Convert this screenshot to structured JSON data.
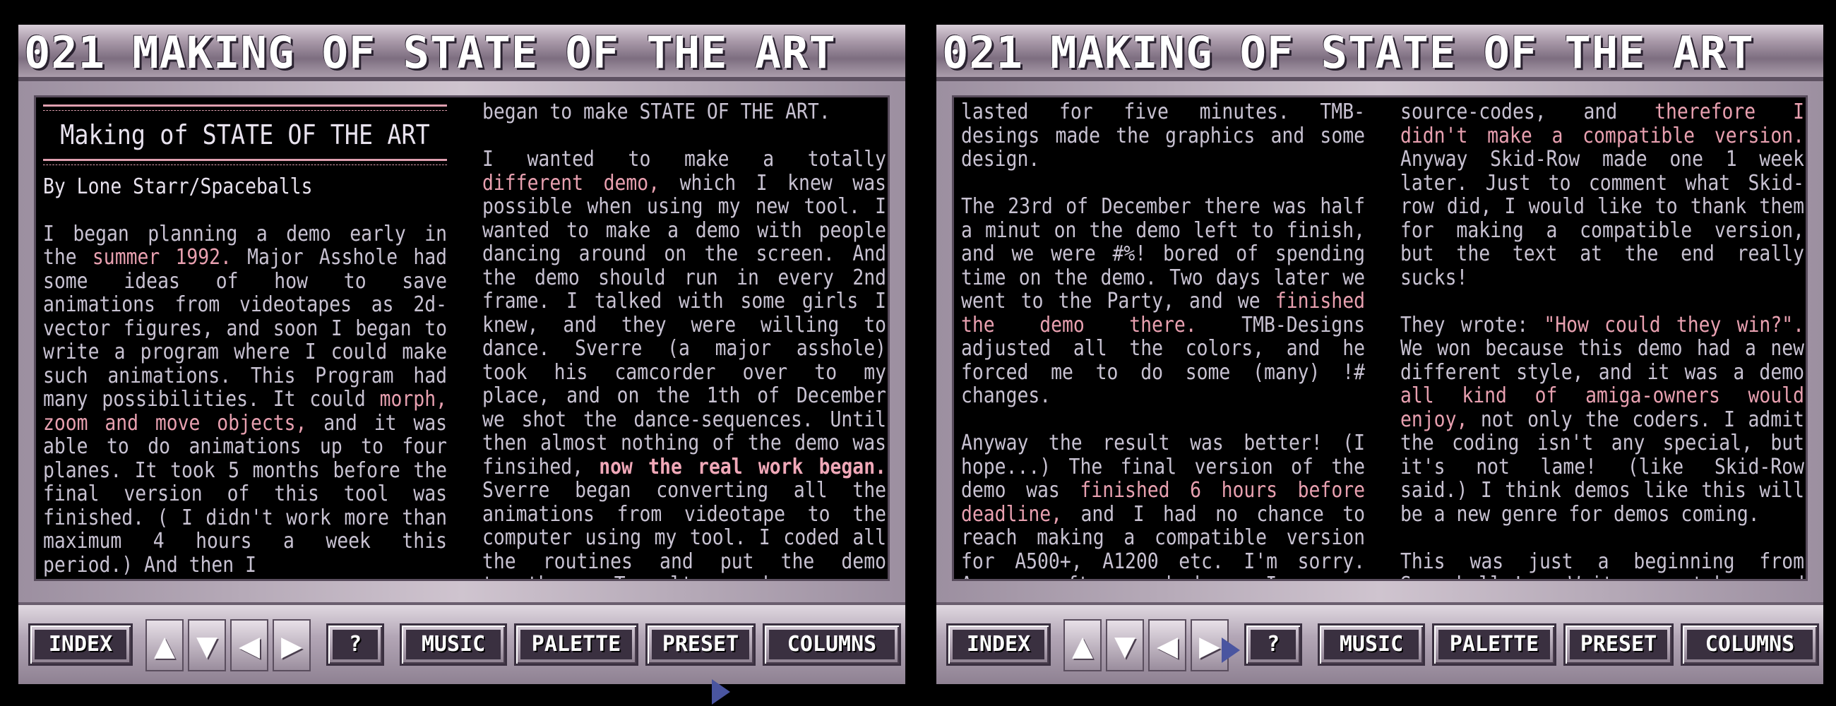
{
  "panels": [
    {
      "title": "021  MAKING OF STATE OF THE ART",
      "toolbar": {
        "index": "INDEX",
        "up": "▲",
        "down": "▼",
        "left": "◀",
        "right": "▶",
        "help": "?",
        "music": "MUSIC",
        "palette": "PALETTE",
        "preset": "PRESET",
        "columns": "COLUMNS"
      },
      "article_title": "Making of STATE OF THE ART",
      "byline": "By Lone Starr/Spaceballs",
      "col1": {
        "p1_a": "I began planning a demo early in the ",
        "p1_hl1": "summer 1992.",
        "p1_b": " Major Asshole had some ideas of how to save animations from videotapes as 2d-vector figures, and soon I began to write a program where I could make such animations. This Program had many possibilities. It could ",
        "p1_hl2": "morph, zoom and  move objects,",
        "p1_c": " and it was able to do animations up to four planes. It took 5 months before the final version of this tool was finished. ( I didn't work more than maximum 4 hours a week this period.) And then I"
      },
      "col2": {
        "p0": "began to make STATE OF THE ART.",
        "p1_a": "I wanted to make a totally ",
        "p1_hl1": "different demo,",
        "p1_b": " which I knew was possible when using my new tool. I wanted to make a demo with people dancing around on the screen. And the demo should run in every 2nd frame. I talked with some girls I knew, and they were willing to dance. Sverre (a major asshole) took his camcorder over to my place, and on the 1th of December we shot the dance-sequences. Until then almost nothing of the demo was finsihed, ",
        "p1_hl2": "now the real work began.",
        "p1_c": " Sverre began converting all the animations from videotape to the computer using my tool. I coded all the routines and put the demo together. Travolta made a new version of the music, the first version"
      }
    },
    {
      "title": "021  MAKING OF STATE OF THE ART",
      "toolbar": {
        "index": "INDEX",
        "up": "▲",
        "down": "▼",
        "left": "◀",
        "right": "▶",
        "help": "?",
        "music": "MUSIC",
        "palette": "PALETTE",
        "preset": "PRESET",
        "columns": "COLUMNS"
      },
      "col1": {
        "p1": "lasted for five minutes. TMB-desings made the graphics and some design.",
        "p2_a": "The 23rd of December there was half a minut on the demo left to finish, and we were #%! bored of spending time on the demo. Two days later we went to the Party, and we ",
        "p2_hl": "finished the demo there.",
        "p2_b": " TMB-Designs adjusted all the colors, and he forced me to do some (many) !# changes.",
        "p3_a": "Anyway the result was better! (I hope...) The final version of the demo was ",
        "p3_hl": "finished 6 hours before deadline,",
        "p3_b": " and I had no chance to reach making a compatible version for A500+, A1200 etc.  I'm sorry. Anyway, after we had won I was so ##^! bored of the demo, that  I  almost  burned  all  my"
      },
      "col2": {
        "p1_a": "source-codes, and ",
        "p1_hl": "therefore I didn't make a compatible version.",
        "p1_b": " Anyway Skid-Row made one 1 week later. Just to comment what Skid-row did, I would like to thank them for making a compatible version, but the text at the end really sucks!",
        "p2_a": "They wrote: ",
        "p2_hl1": "\"How could they win?\".",
        "p2_b": " We won because this demo had a new different style, and it was a demo ",
        "p2_hl2": "all kind of amiga-owners would enjoy,",
        "p2_c": " not only the coders. I admit the coding isn't any special, but it's not lame! (like Skid-Row said.) I think demos like this will be a new genre for demos coming.",
        "p3": "This was just a beginning from Spaceballs! Wait, watch and wriggle!.....??"
      }
    }
  ]
}
